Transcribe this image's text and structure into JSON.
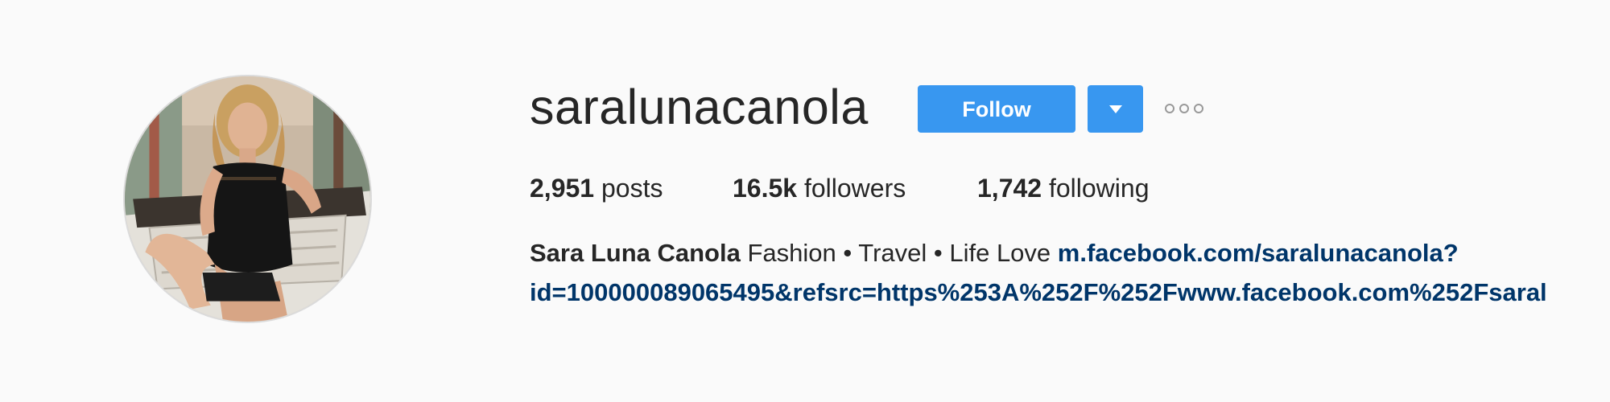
{
  "profile": {
    "username": "saralunacanola",
    "avatar_icon": "profile-photo",
    "follow_label": "Follow",
    "dropdown_icon": "caret-down-icon",
    "options_icon": "more-options-icon"
  },
  "stats": {
    "posts_count": "2,951",
    "posts_label": "posts",
    "followers_count": "16.5k",
    "followers_label": "followers",
    "following_count": "1,742",
    "following_label": "following"
  },
  "bio": {
    "full_name": "Sara Luna Canola",
    "text": "Fashion • Travel • Life Love",
    "link_line1": "m.facebook.com/saralunacanola?",
    "link_line2": "id=100000089065495&refsrc=https%253A%252F%252Fwww.facebook.com%252Fsaral"
  },
  "colors": {
    "accent": "#3897f0",
    "link": "#003569",
    "background": "#fafafa",
    "text": "#262626"
  }
}
